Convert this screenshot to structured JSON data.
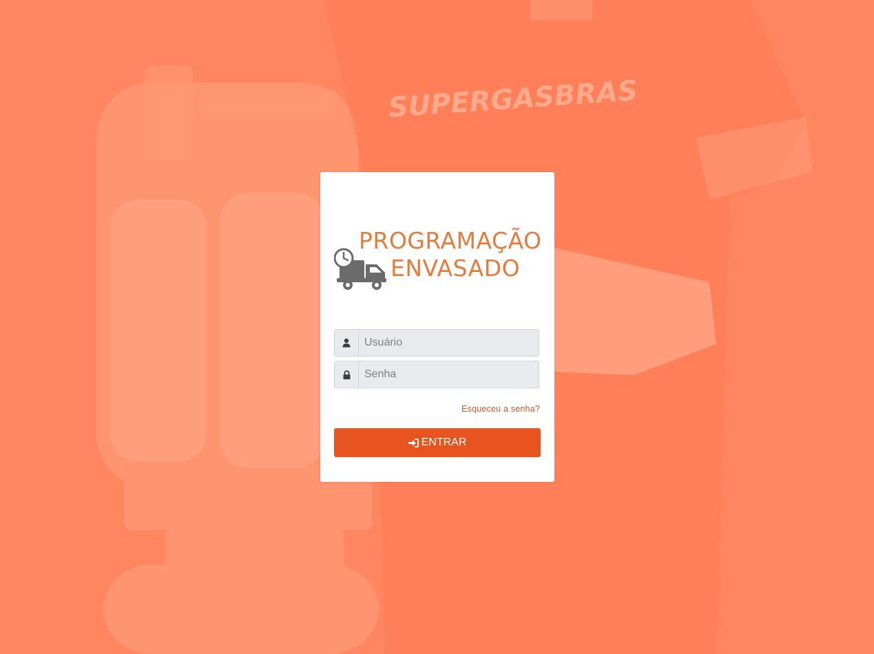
{
  "background": {
    "overlay_color": "#ff8660",
    "brand_watermark": "SUPERGASBRAS"
  },
  "logo": {
    "line1": "PROGRAMAÇÃO",
    "line2": "ENVASADO",
    "icon": "truck-clock-icon",
    "text_color": "#e87a3a"
  },
  "form": {
    "username": {
      "placeholder": "Usuário",
      "value": "",
      "icon": "user-icon"
    },
    "password": {
      "placeholder": "Senha",
      "value": "",
      "icon": "lock-icon"
    },
    "forgot_label": "Esqueceu a senha?",
    "submit_label": "ENTRAR",
    "submit_icon": "sign-in-icon",
    "accent_color": "#e8541f"
  }
}
